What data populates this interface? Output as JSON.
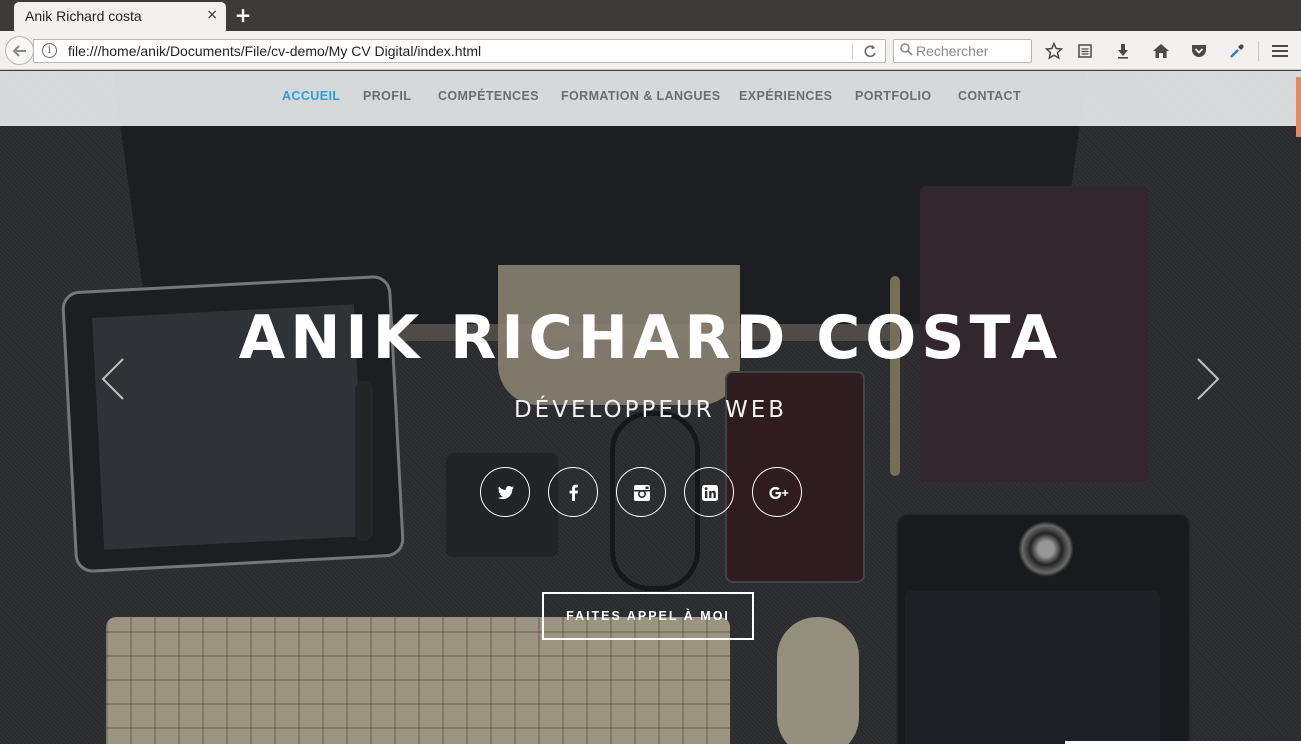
{
  "browser": {
    "tab_title": "Anik Richard costa",
    "tab_close": "×",
    "new_tab": "+",
    "url": "file:///home/anik/Documents/File/cv-demo/My CV Digital/index.html",
    "search_placeholder": "Rechercher",
    "toolbar_icons": [
      "back-icon",
      "info-icon",
      "reload-icon",
      "search-icon",
      "bookmark-star-icon",
      "reading-list-icon",
      "download-icon",
      "home-icon",
      "pocket-icon",
      "eyedropper-icon",
      "menu-icon"
    ]
  },
  "site": {
    "nav": [
      {
        "label": "ACCUEIL",
        "active": true
      },
      {
        "label": "PROFIL",
        "active": false
      },
      {
        "label": "COMPÉTENCES",
        "active": false
      },
      {
        "label": "FORMATION & LANGUES",
        "active": false
      },
      {
        "label": "EXPÉRIENCES",
        "active": false
      },
      {
        "label": "PORTFOLIO",
        "active": false
      },
      {
        "label": "CONTACT",
        "active": false
      }
    ],
    "active_color": "#2d9ee0",
    "hero": {
      "name": "ANIK RICHARD COSTA",
      "role": "DÉVELOPPEUR WEB",
      "cta": "FAITES APPEL À MOI",
      "social": [
        "twitter-icon",
        "facebook-icon",
        "instagram-icon",
        "linkedin-icon",
        "google-plus-icon"
      ]
    }
  }
}
